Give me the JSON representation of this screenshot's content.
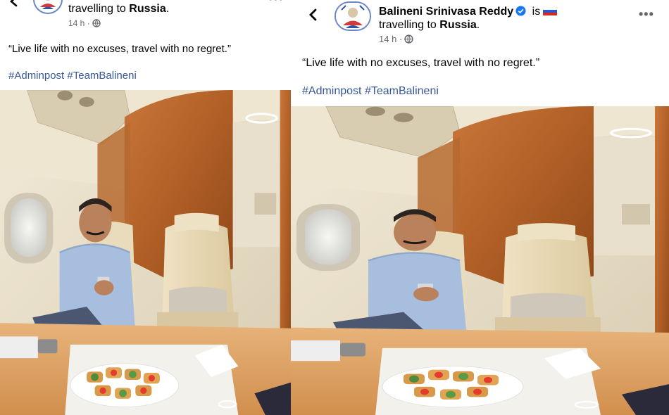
{
  "post": {
    "author_name": "Balineni Srinivasa Reddy",
    "status_word": "is",
    "travel_prefix": "travelling to",
    "travel_place": "Russia",
    "travel_suffix": ".",
    "timestamp": "14 h ·",
    "caption": "“Live life with no excuses, travel with no regret.”",
    "hashtags": [
      "#Adminpost",
      "#TeamBalineni"
    ]
  },
  "icons": {
    "back": "chevron-left-icon",
    "verified": "verified-badge-icon",
    "flag": "russia-flag-icon",
    "privacy": "globe-icon",
    "more": "more-options-icon"
  },
  "colors": {
    "hashtag": "#385898",
    "verified": "#1877f2",
    "meta_text": "#65676b"
  }
}
